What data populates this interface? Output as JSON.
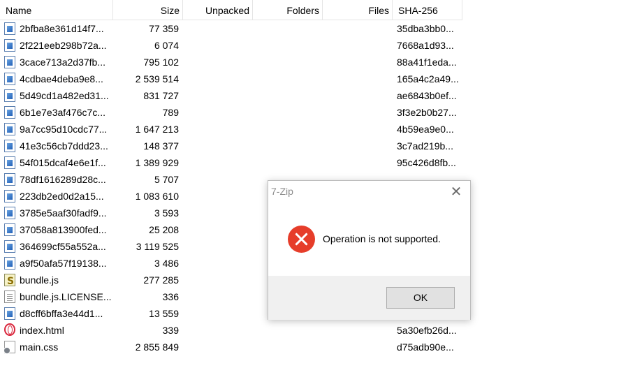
{
  "columns": {
    "name": "Name",
    "size": "Size",
    "unpacked": "Unpacked",
    "folders": "Folders",
    "files": "Files",
    "sha": "SHA-256"
  },
  "rows": [
    {
      "name": "2bfba8e361d14f7...",
      "size": "77 359",
      "sha": "35dba3bb0...",
      "icon": "image-file-icon"
    },
    {
      "name": "2f221eeb298b72a...",
      "size": "6 074",
      "sha": "7668a1d93...",
      "icon": "image-file-icon"
    },
    {
      "name": "3cace713a2d37fb...",
      "size": "795 102",
      "sha": "88a41f1eda...",
      "icon": "image-file-icon"
    },
    {
      "name": "4cdbae4deba9e8...",
      "size": "2 539 514",
      "sha": "165a4c2a49...",
      "icon": "image-file-icon"
    },
    {
      "name": "5d49cd1a482ed31...",
      "size": "831 727",
      "sha": "ae6843b0ef...",
      "icon": "image-file-icon"
    },
    {
      "name": "6b1e7e3af476c7c...",
      "size": "789",
      "sha": "3f3e2b0b27...",
      "icon": "image-file-icon"
    },
    {
      "name": "9a7cc95d10cdc77...",
      "size": "1 647 213",
      "sha": "4b59ea9e0...",
      "icon": "image-file-icon"
    },
    {
      "name": "41e3c56cb7ddd23...",
      "size": "148 377",
      "sha": "3c7ad219b...",
      "icon": "image-file-icon"
    },
    {
      "name": "54f015dcaf4e6e1f...",
      "size": "1 389 929",
      "sha": "95c426d8fb...",
      "icon": "image-file-icon"
    },
    {
      "name": "78df1616289d28c...",
      "size": "5 707",
      "sha": "",
      "icon": "image-file-icon"
    },
    {
      "name": "223db2ed0d2a15...",
      "size": "1 083 610",
      "sha": "",
      "icon": "image-file-icon"
    },
    {
      "name": "3785e5aaf30fadf9...",
      "size": "3 593",
      "sha": "",
      "icon": "image-file-icon"
    },
    {
      "name": "37058a813900fed...",
      "size": "25 208",
      "sha": "",
      "icon": "image-file-icon"
    },
    {
      "name": "364699cf55a552a...",
      "size": "3 119 525",
      "sha": "",
      "icon": "image-file-icon"
    },
    {
      "name": "a9f50afa57f19138...",
      "size": "3 486",
      "sha": "",
      "icon": "image-file-icon"
    },
    {
      "name": "bundle.js",
      "size": "277 285",
      "sha": "",
      "icon": "javascript-file-icon"
    },
    {
      "name": "bundle.js.LICENSE...",
      "size": "336",
      "sha": "",
      "icon": "text-file-icon"
    },
    {
      "name": "d8cff6bffa3e44d1...",
      "size": "13 559",
      "sha": "",
      "icon": "image-file-icon"
    },
    {
      "name": "index.html",
      "size": "339",
      "sha": "5a30efb26d...",
      "icon": "html-file-icon"
    },
    {
      "name": "main.css",
      "size": "2 855 849",
      "sha": "d75adb90e...",
      "icon": "css-file-icon"
    }
  ],
  "dialog": {
    "title": "7-Zip",
    "close_glyph": "✕",
    "icon": "error-icon",
    "message": "Operation is not supported.",
    "ok_label": "OK"
  },
  "colors": {
    "error_red": "#e63d2a",
    "dialog_footer": "#f0f0f0",
    "button_face": "#e1e1e1"
  }
}
